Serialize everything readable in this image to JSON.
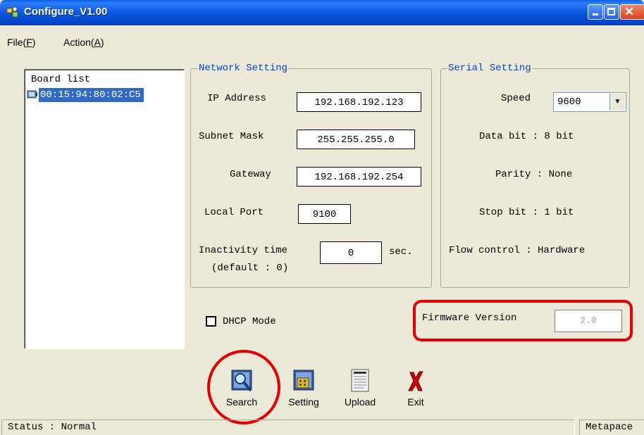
{
  "window": {
    "title": "Configure_V1.00"
  },
  "menu": {
    "file": {
      "label": "File(",
      "mnemonic": "F",
      "close": ")"
    },
    "action": {
      "label": "Action(",
      "mnemonic": "A",
      "close": ")"
    }
  },
  "board_list": {
    "title": "Board list",
    "items": [
      "00:15:94:80:02:C5"
    ]
  },
  "network": {
    "group_title": "Network Setting",
    "ip_label": "IP Address",
    "ip_value": "192.168.192.123",
    "subnet_label": "Subnet Mask",
    "subnet_value": "255.255.255.0",
    "gateway_label": "Gateway",
    "gateway_value": "192.168.192.254",
    "port_label": "Local Port",
    "port_value": "9100",
    "inactivity_label": "Inactivity time",
    "inactivity_default": "(default : 0)",
    "inactivity_value": "0",
    "inactivity_unit": "sec."
  },
  "serial": {
    "group_title": "Serial Setting",
    "speed_label": "Speed",
    "speed_value": "9600",
    "data_bit": "Data bit : 8 bit",
    "parity": "Parity : None",
    "stop_bit": "Stop bit : 1 bit",
    "flow_control": "Flow control : Hardware"
  },
  "dhcp": {
    "label": "DHCP Mode",
    "checked": false
  },
  "firmware": {
    "label": "Firmware Version",
    "value": "2.0"
  },
  "toolbar": {
    "search": "Search",
    "setting": "Setting",
    "upload": "Upload",
    "exit": "Exit"
  },
  "status": {
    "text": "Status : Normal",
    "right": "Metapace"
  },
  "colors": {
    "titlebar": "#0b56e0",
    "selection": "#316ac5",
    "group_label": "#0046d5",
    "annotation": "#e40000",
    "face": "#ece9d8"
  }
}
